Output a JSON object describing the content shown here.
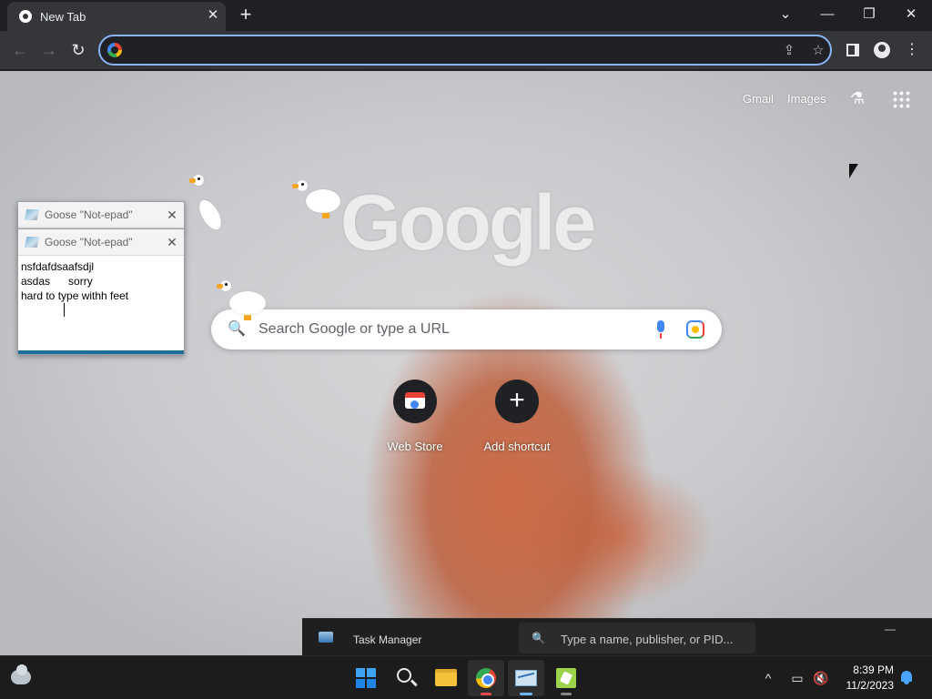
{
  "browser": {
    "tab_title": "New Tab",
    "tab_close_glyph": "✕",
    "new_tab_glyph": "+",
    "window_controls": {
      "dropdown": "⌄",
      "minimize": "—",
      "restore": "❐",
      "close": "✕"
    },
    "nav": {
      "back": "←",
      "forward": "→",
      "reload": "↻"
    },
    "omnibox": {
      "value": "",
      "placeholder": ""
    },
    "omnibox_actions": {
      "share": "⇪",
      "bookmark": "☆"
    },
    "menu_glyph": "⋮"
  },
  "ntp": {
    "top_links": {
      "gmail": "Gmail",
      "images": "Images"
    },
    "labs_glyph": "⚗",
    "logo_text": "Google",
    "search": {
      "placeholder": "Search Google or type a URL",
      "icon_glyph": "🔍"
    },
    "shortcuts": [
      {
        "label": "Web Store",
        "icon": "web-store-icon"
      },
      {
        "label": "Add shortcut",
        "icon": "plus-icon",
        "glyph": "+"
      }
    ]
  },
  "notepads": [
    {
      "title": "Goose \"Not-epad\"",
      "close_glyph": "✕"
    },
    {
      "title": "Goose \"Not-epad\"",
      "close_glyph": "✕",
      "text": "nsfdafdsaafsdjl\nasdas      sorry\nhard to type withh feet"
    }
  ],
  "task_manager": {
    "title": "Task Manager",
    "search_placeholder": "Type a name, publisher, or PID...",
    "search_glyph": "🔍",
    "minimize_glyph": "—"
  },
  "taskbar": {
    "apps": [
      "start",
      "search",
      "file-explorer",
      "chrome",
      "task-manager",
      "desktop-goose"
    ],
    "tray": {
      "chevron": "^",
      "time": "8:39 PM",
      "date": "11/2/2023"
    }
  },
  "colors": {
    "omnibox_focus": "#8ab4f8",
    "taskbar_bg": "#1c1c1c",
    "tab_active": "#35363a"
  }
}
